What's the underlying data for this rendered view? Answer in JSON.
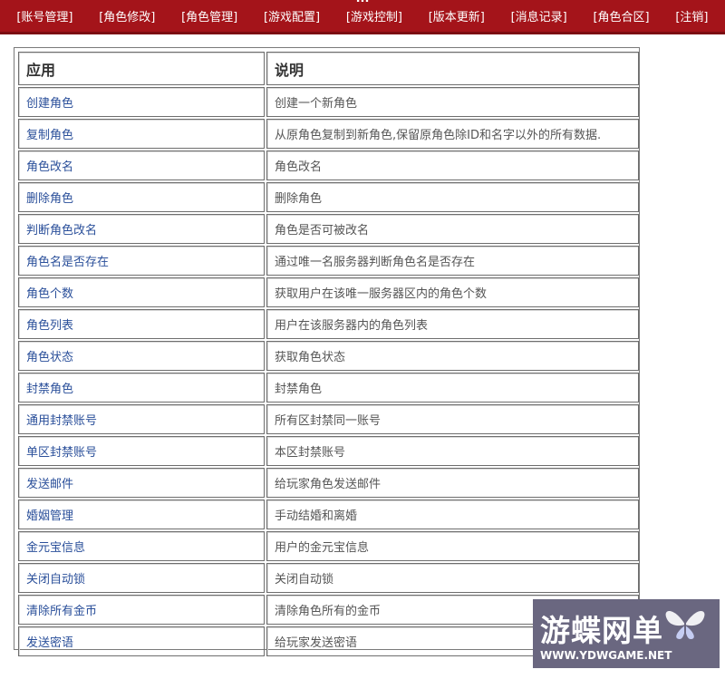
{
  "header": {
    "title": "...",
    "nav": [
      "[账号管理]",
      "[角色修改]",
      "[角色管理]",
      "[游戏配置]",
      "[游戏控制]",
      "[版本更新]",
      "[消息记录]",
      "[角色合区]",
      "[注销]"
    ]
  },
  "table": {
    "headers": [
      "应用",
      "说明"
    ],
    "rows": [
      {
        "name": "创建角色",
        "desc": "创建一个新角色"
      },
      {
        "name": "复制角色",
        "desc": "从原角色复制到新角色,保留原角色除ID和名字以外的所有数据."
      },
      {
        "name": "角色改名",
        "desc": "角色改名"
      },
      {
        "name": "删除角色",
        "desc": "删除角色"
      },
      {
        "name": "判断角色改名",
        "desc": "角色是否可被改名"
      },
      {
        "name": "角色名是否存在",
        "desc": "通过唯一名服务器判断角色名是否存在"
      },
      {
        "name": "角色个数",
        "desc": "获取用户在该唯一服务器区内的角色个数"
      },
      {
        "name": "角色列表",
        "desc": "用户在该服务器内的角色列表"
      },
      {
        "name": "角色状态",
        "desc": "获取角色状态"
      },
      {
        "name": "封禁角色",
        "desc": "封禁角色"
      },
      {
        "name": "通用封禁账号",
        "desc": "所有区封禁同一账号"
      },
      {
        "name": "单区封禁账号",
        "desc": "本区封禁账号"
      },
      {
        "name": "发送邮件",
        "desc": "给玩家角色发送邮件"
      },
      {
        "name": "婚姻管理",
        "desc": "手动结婚和离婚"
      },
      {
        "name": "金元宝信息",
        "desc": "用户的金元宝信息"
      },
      {
        "name": "关闭自动锁",
        "desc": "关闭自动锁"
      },
      {
        "name": "清除所有金币",
        "desc": "清除角色所有的金币"
      },
      {
        "name": "发送密语",
        "desc": "给玩家发送密语"
      }
    ]
  },
  "watermark": {
    "brand": "游蝶网单",
    "url": "WWW.YDWGAME.NET",
    "icon": "butterfly-icon"
  },
  "colors": {
    "header_bg": "#a4141a",
    "link": "#2a4f9a",
    "desc_text": "#555555",
    "watermark_bg": "#6a6780"
  }
}
